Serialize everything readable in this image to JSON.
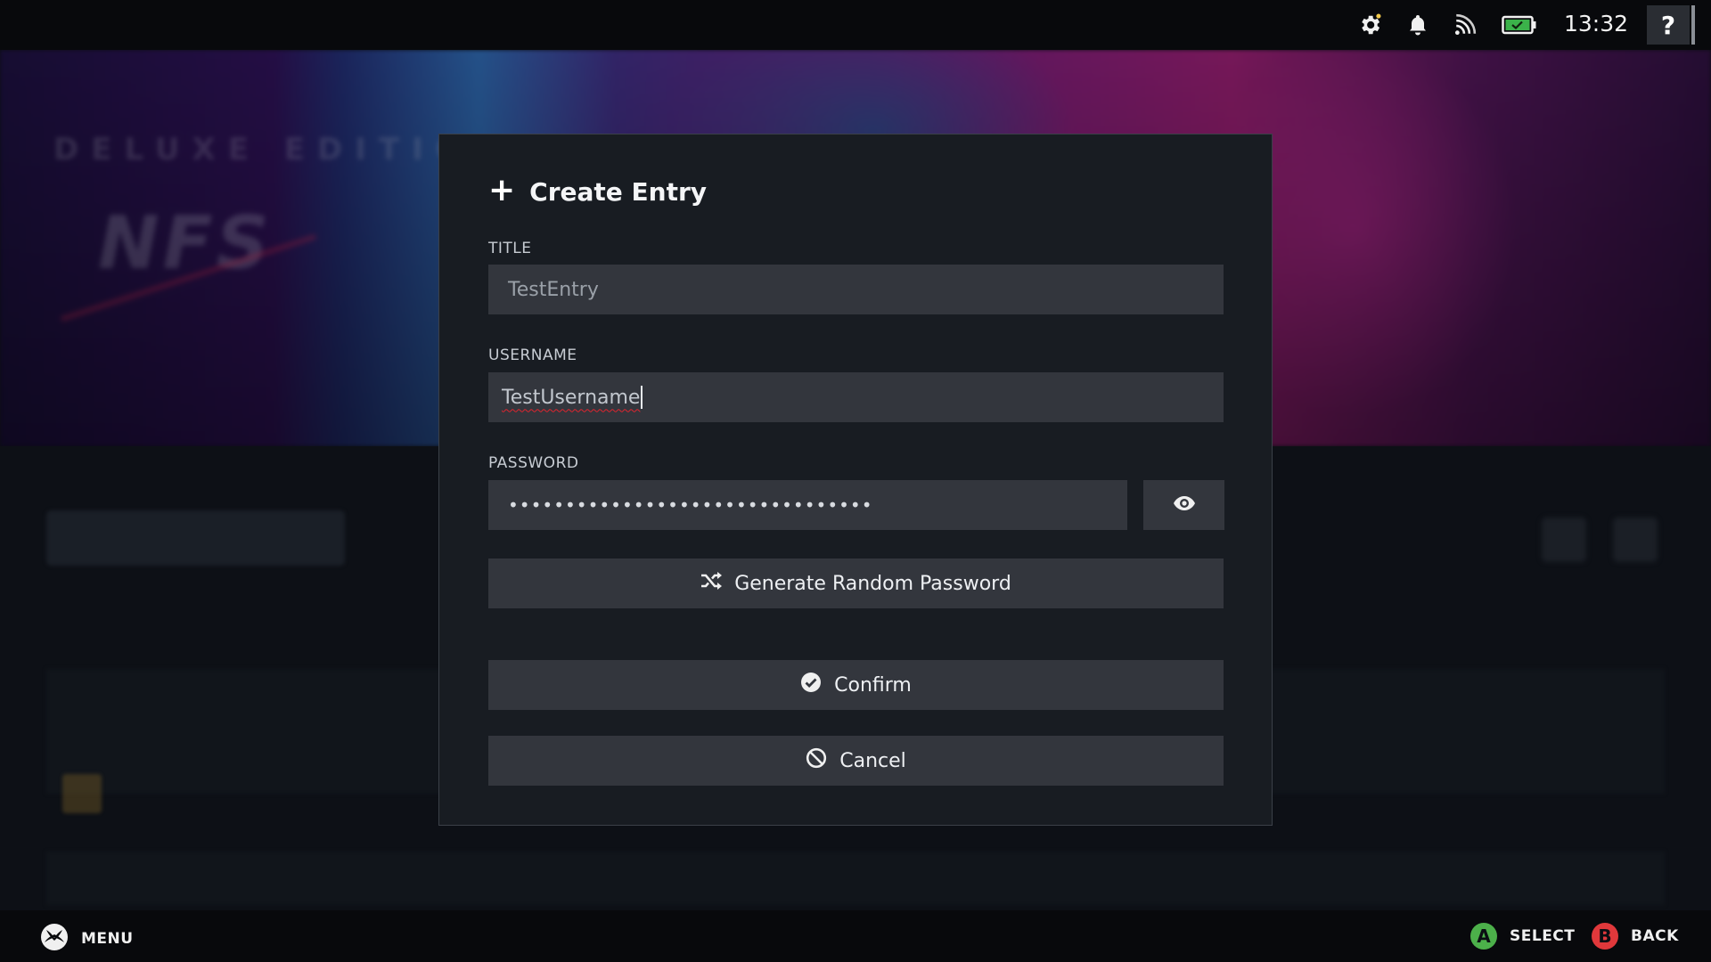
{
  "background": {
    "hero_edition": "DELUXE EDITION",
    "hero_logo": "NFS"
  },
  "topbar": {
    "icons": [
      "settings-icon",
      "notification-bell-icon",
      "cast-signal-icon",
      "battery-charging-icon"
    ],
    "clock": "13:32",
    "help_label": "?"
  },
  "dialog": {
    "title": "Create Entry",
    "title_icon": "plus-icon",
    "fields": {
      "title": {
        "label": "TITLE",
        "value": "TestEntry"
      },
      "username": {
        "label": "USERNAME",
        "value": "TestUsername"
      },
      "password": {
        "label": "PASSWORD",
        "value": "••••••••••••••••••••••••••••••••"
      }
    },
    "generate_label": "Generate Random Password",
    "confirm_label": "Confirm",
    "cancel_label": "Cancel"
  },
  "bottombar": {
    "menu_label": "MENU",
    "select_glyph": "A",
    "select_label": "SELECT",
    "back_glyph": "B",
    "back_label": "BACK",
    "colors": {
      "a_button": "#4cb04a",
      "b_button": "#e0383b"
    }
  }
}
